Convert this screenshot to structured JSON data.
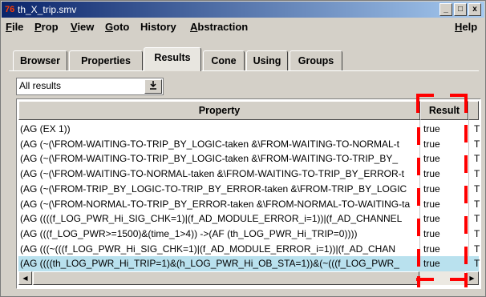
{
  "window": {
    "title": "th_X_trip.smv",
    "app_icon": "76"
  },
  "window_buttons": {
    "minimize": "_",
    "maximize": "□",
    "close": "x"
  },
  "menu": {
    "items": [
      {
        "first": "F",
        "rest": "ile"
      },
      {
        "first": "P",
        "rest": "rop"
      },
      {
        "first": "V",
        "rest": "iew"
      },
      {
        "first": "G",
        "rest": "oto"
      },
      {
        "first": "Hi",
        "rest": "story",
        "underline_index": 1
      },
      {
        "first": "A",
        "rest": "bstraction"
      }
    ],
    "help": {
      "first": "H",
      "rest": "elp"
    }
  },
  "tabs": [
    {
      "label": "Browser"
    },
    {
      "label": "Properties"
    },
    {
      "label": "Results",
      "active": true
    },
    {
      "label": "Cone"
    },
    {
      "label": "Using"
    },
    {
      "label": "Groups"
    }
  ],
  "filter": {
    "value": "All results",
    "button_icon": "down-arrow-to-line"
  },
  "table": {
    "headers": {
      "property": "Property",
      "result": "Result"
    },
    "rows": [
      {
        "property": "(AG (EX 1))",
        "result": "true",
        "extra": "T"
      },
      {
        "property": "(AG (~(\\FROM-WAITING-TO-TRIP_BY_LOGIC-taken &\\FROM-WAITING-TO-NORMAL-t",
        "result": "true",
        "extra": "T"
      },
      {
        "property": "(AG (~(\\FROM-WAITING-TO-TRIP_BY_LOGIC-taken &\\FROM-WAITING-TO-TRIP_BY_",
        "result": "true",
        "extra": "T"
      },
      {
        "property": "(AG (~(\\FROM-WAITING-TO-NORMAL-taken &\\FROM-WAITING-TO-TRIP_BY_ERROR-t",
        "result": "true",
        "extra": "T"
      },
      {
        "property": "(AG (~(\\FROM-TRIP_BY_LOGIC-TO-TRIP_BY_ERROR-taken &\\FROM-TRIP_BY_LOGIC",
        "result": "true",
        "extra": "T"
      },
      {
        "property": "(AG (~(\\FROM-NORMAL-TO-TRIP_BY_ERROR-taken &\\FROM-NORMAL-TO-WAITING-ta",
        "result": "true",
        "extra": "T"
      },
      {
        "property": "(AG ((((f_LOG_PWR_Hi_SIG_CHK=1)|(f_AD_MODULE_ERROR_i=1))|(f_AD_CHANNEL",
        "result": "true",
        "extra": "T"
      },
      {
        "property": "(AG (((f_LOG_PWR>=1500)&(time_1>4)) ->(AF (th_LOG_PWR_Hi_TRIP=0))))",
        "result": "true",
        "extra": "T"
      },
      {
        "property": "(AG (((~(((f_LOG_PWR_Hi_SIG_CHK=1)|(f_AD_MODULE_ERROR_i=1))|(f_AD_CHAN",
        "result": "true",
        "extra": "T"
      },
      {
        "property": "(AG ((((th_LOG_PWR_Hi_TRIP=1)&(h_LOG_PWR_Hi_OB_STA=1))&(~(((f_LOG_PWR_",
        "result": "true",
        "extra": "T",
        "selected": true
      }
    ]
  },
  "scrollbar": {
    "left_icon": "◀",
    "right_icon": "▶"
  },
  "colors": {
    "annotation": "#ff0000",
    "selected_row": "#b9e1ee",
    "title_bar": "#0a246a"
  }
}
